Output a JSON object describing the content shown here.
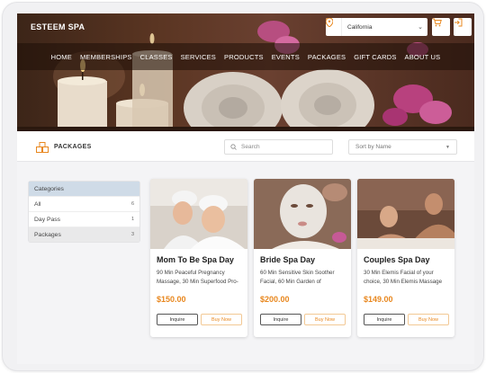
{
  "brand": "ESTEEM SPA",
  "location": {
    "value": "California"
  },
  "nav": [
    "HOME",
    "MEMBERSHIPS",
    "CLASSES",
    "SERVICES",
    "PRODUCTS",
    "EVENTS",
    "PACKAGES",
    "GIFT CARDS",
    "ABOUT US"
  ],
  "toolbar": {
    "title": "PACKAGES",
    "search_placeholder": "Search",
    "sort_value": "Sort by Name"
  },
  "categories": {
    "header": "Categories",
    "items": [
      {
        "label": "All",
        "count": "6"
      },
      {
        "label": "Day Pass",
        "count": "1"
      },
      {
        "label": "Packages",
        "count": "3"
      }
    ]
  },
  "packages": [
    {
      "title": "Mom To Be Spa Day",
      "desc": "90 Min Peaceful Pregnancy Massage, 30 Min Superfood Pro-",
      "price": "$150.00",
      "inquire": "Inquire",
      "buy": "Buy Now"
    },
    {
      "title": "Bride Spa Day",
      "desc": "60 Min Sensitive Skin Soother Facial, 60 Min Garden of",
      "price": "$200.00",
      "inquire": "Inquire",
      "buy": "Buy Now"
    },
    {
      "title": "Couples Spa Day",
      "desc": "30 Min Elemis Facial of your choice, 30 Min Elemis Massage",
      "price": "$149.00",
      "inquire": "Inquire",
      "buy": "Buy Now"
    }
  ],
  "colors": {
    "accent": "#e8871e",
    "category_header": "#cfdbe7",
    "nav_overlay": "#1e0e08"
  }
}
